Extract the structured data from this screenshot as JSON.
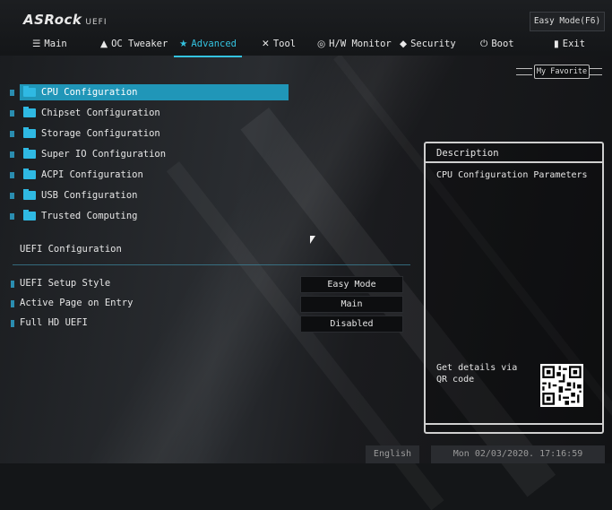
{
  "header": {
    "logo": "ASRock",
    "logo_suffix": "UEFI",
    "mode_button": "Easy Mode(F6)"
  },
  "tabs": [
    {
      "label": "Main",
      "icon": "list-icon"
    },
    {
      "label": "OC Tweaker",
      "icon": "flask-icon"
    },
    {
      "label": "Advanced",
      "icon": "star-icon",
      "active": true
    },
    {
      "label": "Tool",
      "icon": "tools-icon"
    },
    {
      "label": "H/W Monitor",
      "icon": "gauge-icon"
    },
    {
      "label": "Security",
      "icon": "shield-icon"
    },
    {
      "label": "Boot",
      "icon": "power-icon"
    },
    {
      "label": "Exit",
      "icon": "exit-icon"
    }
  ],
  "favorite": {
    "label": "My Favorite"
  },
  "menu": {
    "items": [
      {
        "label": "CPU Configuration",
        "selected": true
      },
      {
        "label": "Chipset Configuration"
      },
      {
        "label": "Storage Configuration"
      },
      {
        "label": "Super IO Configuration"
      },
      {
        "label": "ACPI Configuration"
      },
      {
        "label": "USB Configuration"
      },
      {
        "label": "Trusted Computing"
      }
    ]
  },
  "uefi": {
    "section_title": "UEFI Configuration",
    "settings": [
      {
        "label": "UEFI Setup Style",
        "value": "Easy Mode"
      },
      {
        "label": "Active Page on Entry",
        "value": "Main"
      },
      {
        "label": "Full HD UEFI",
        "value": "Disabled"
      }
    ]
  },
  "description": {
    "title": "Description",
    "body": "CPU Configuration Parameters",
    "qr_text": "Get details via QR code"
  },
  "footer": {
    "language": "English",
    "datetime": "Mon 02/03/2020. 17:16:59"
  },
  "colors": {
    "accent": "#34c3e0",
    "selection": "#2096b8"
  }
}
